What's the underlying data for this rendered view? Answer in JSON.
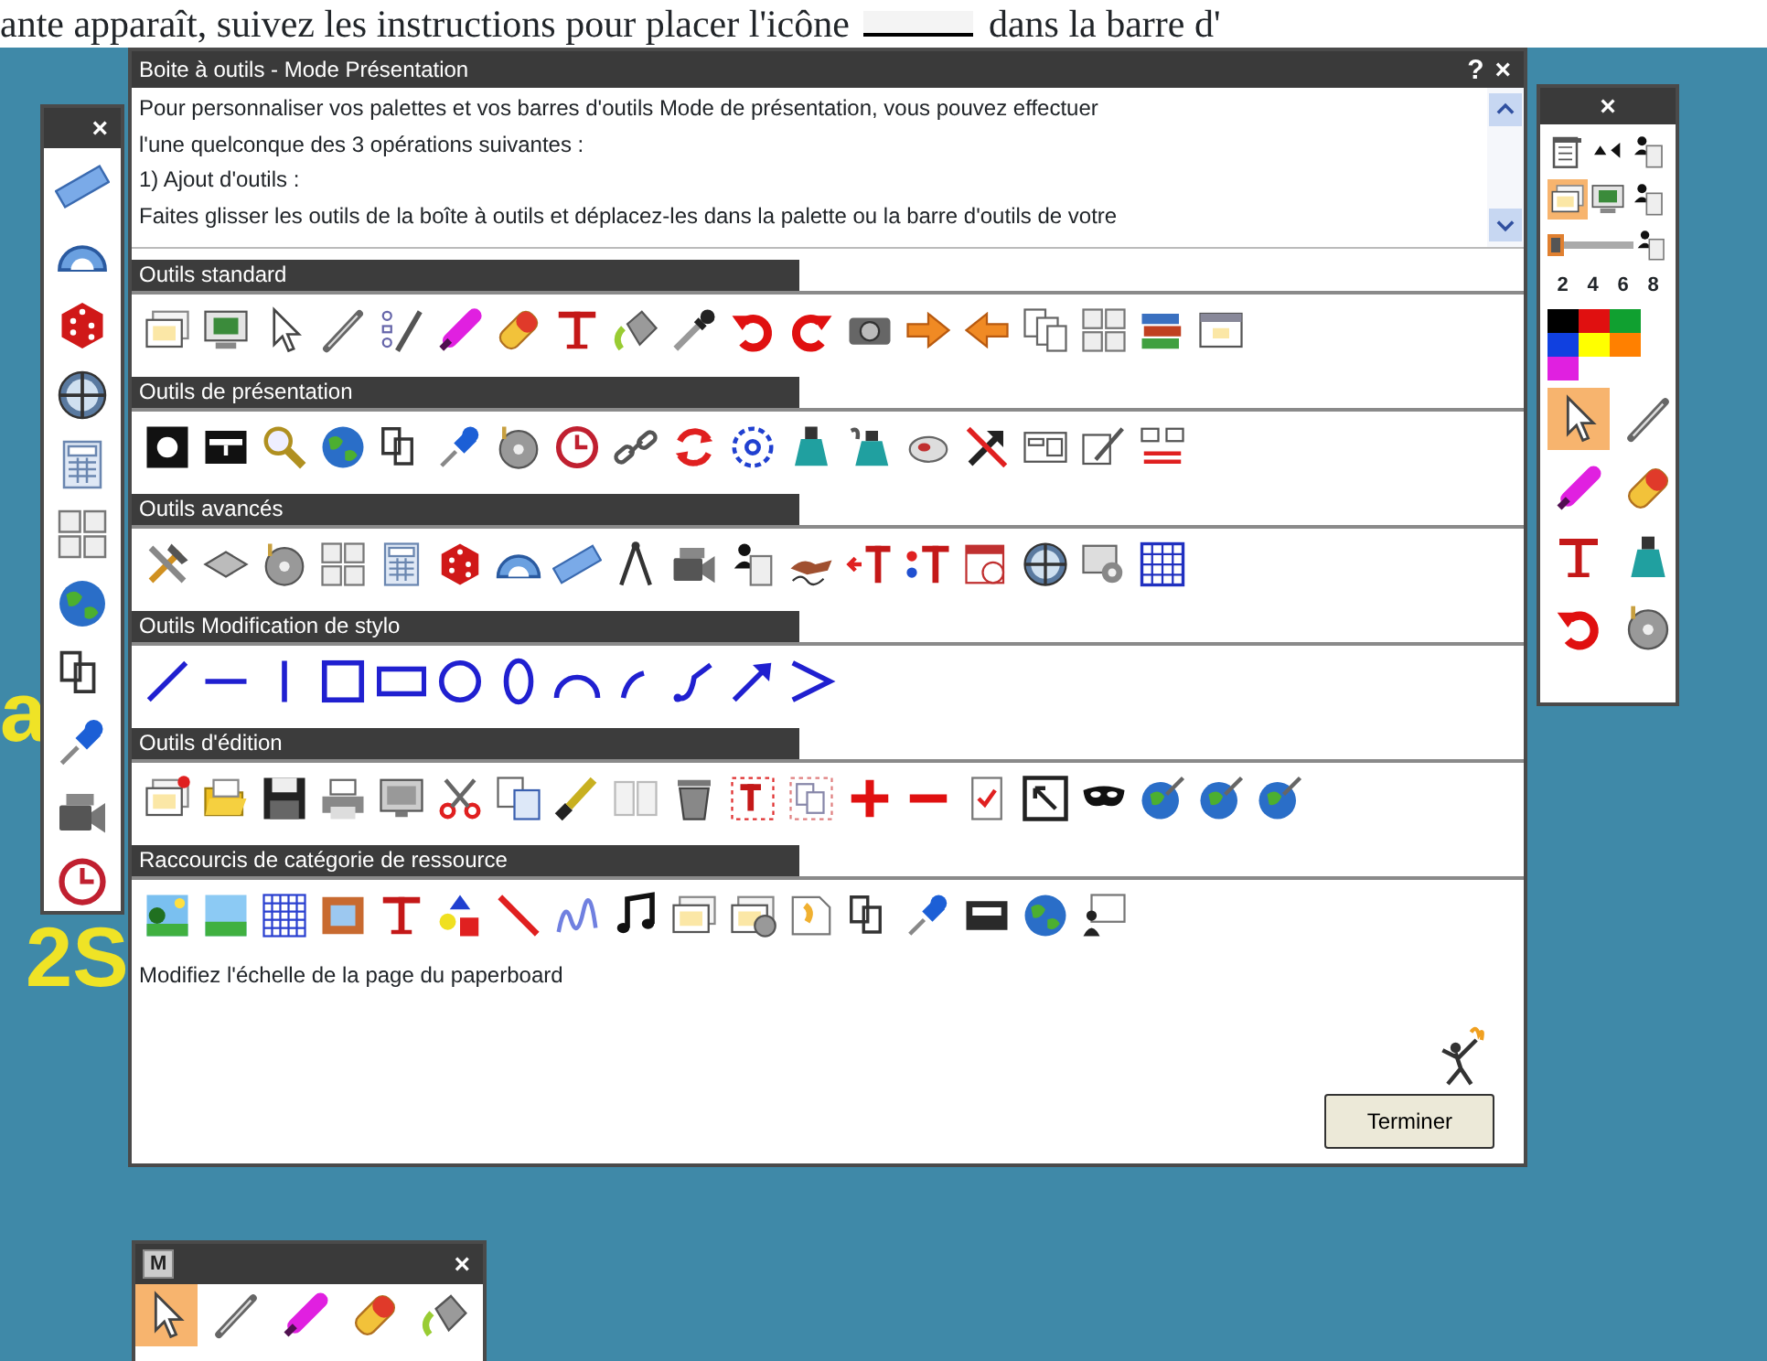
{
  "page_text": [
    "ante apparaît, suivez les instructions pour placer l'icône",
    "dans la barre d'"
  ],
  "background_text": [
    "a",
    "2S"
  ],
  "dialog": {
    "title": "Boite à outils - Mode Présentation",
    "help": "?",
    "close": "×",
    "intro_lines": [
      "Pour personnaliser vos palettes et vos barres d'outils Mode de présentation, vous pouvez effectuer",
      "l'une quelconque des 3 opérations suivantes :",
      "1) Ajout d'outils :",
      "Faites glisser les outils de la boîte à outils et déplacez-les dans la palette ou la barre d'outils de votre"
    ],
    "sections": [
      {
        "title": "Outils standard"
      },
      {
        "title": "Outils de présentation"
      },
      {
        "title": "Outils avancés"
      },
      {
        "title": "Outils Modification de stylo"
      },
      {
        "title": "Outils d'édition"
      },
      {
        "title": "Raccourcis de catégorie de ressource"
      }
    ],
    "description": "Modifiez l'échelle de la page du paperboard",
    "finish_button": "Terminer"
  },
  "left_palette": {
    "close": "×",
    "tools": [
      {
        "kind": "ruler",
        "selected": false
      },
      {
        "kind": "protractor",
        "selected": false
      },
      {
        "kind": "dice",
        "selected": false
      },
      {
        "kind": "crosshair",
        "selected": false
      },
      {
        "kind": "calculator",
        "selected": false
      },
      {
        "kind": "pagegrid",
        "selected": false
      },
      {
        "kind": "globe",
        "selected": false
      },
      {
        "kind": "pagesout",
        "selected": false
      },
      {
        "kind": "pin",
        "selected": false
      },
      {
        "kind": "video",
        "selected": false
      },
      {
        "kind": "clock",
        "selected": false
      }
    ]
  },
  "right_palette": {
    "close": "×",
    "rows": [
      [
        {
          "kind": "page",
          "selected": false
        },
        {
          "kind": "triangles",
          "selected": false
        },
        {
          "kind": "person",
          "selected": false
        }
      ],
      [
        {
          "kind": "slide",
          "selected": true
        },
        {
          "kind": "monitor",
          "selected": false
        },
        {
          "kind": "person",
          "selected": false
        }
      ]
    ],
    "slider": {
      "level": 0
    },
    "widths": [
      "2",
      "4",
      "6",
      "8"
    ],
    "colors": [
      {
        "color": "#000000"
      },
      {
        "color": "#e01010"
      },
      {
        "color": "#10a030"
      },
      {
        "color": "#1040e0"
      },
      {
        "color": "#ffff00"
      },
      {
        "color": "#ff8000"
      },
      {
        "color": "#e020e0"
      }
    ],
    "tool_rows": [
      [
        {
          "kind": "pointer",
          "selected": true
        },
        {
          "kind": "pen",
          "selected": false
        }
      ],
      [
        {
          "kind": "highlighter",
          "selected": false
        },
        {
          "kind": "eraser",
          "selected": false
        }
      ],
      [
        {
          "kind": "text",
          "selected": false
        },
        {
          "kind": "ink",
          "selected": false
        }
      ],
      [
        {
          "kind": "undo",
          "selected": false
        },
        {
          "kind": "disc",
          "selected": false
        }
      ]
    ]
  },
  "bottom_palette": {
    "mode": "M",
    "close": "×",
    "tools": [
      {
        "kind": "pointer",
        "selected": true
      },
      {
        "kind": "pen",
        "selected": false
      },
      {
        "kind": "highlighter",
        "selected": false
      },
      {
        "kind": "eraser",
        "selected": false
      },
      {
        "kind": "bucket",
        "selected": false
      }
    ]
  }
}
